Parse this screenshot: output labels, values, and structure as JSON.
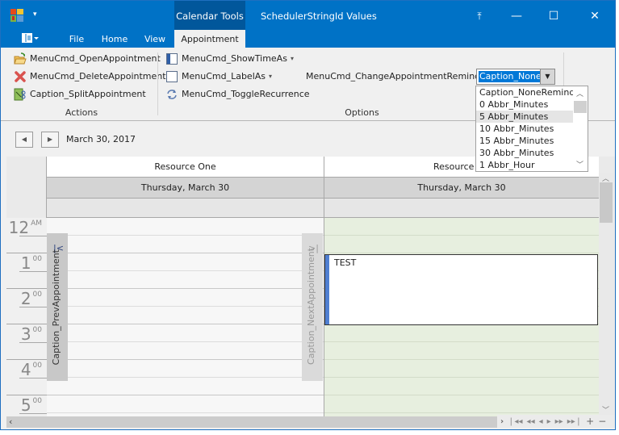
{
  "titlebar": {
    "context_tab": "Calendar Tools",
    "window_title": "SchedulerStringId Values",
    "qat_arrow": "▾",
    "buttons": {
      "restore_ribbon": "⤒",
      "minimize": "—",
      "maximize": "☐",
      "close": "✕"
    }
  },
  "tabs": [
    {
      "label": "File"
    },
    {
      "label": "Home"
    },
    {
      "label": "View"
    },
    {
      "label": "Appointment",
      "active": true
    }
  ],
  "ribbon": {
    "groups": {
      "actions": {
        "label": "Actions",
        "items": [
          {
            "label": "MenuCmd_OpenAppointment",
            "icon": "open-folder-icon"
          },
          {
            "label": "MenuCmd_DeleteAppointment",
            "icon": "delete-x-icon"
          },
          {
            "label": "Caption_SplitAppointment",
            "icon": "split-icon"
          }
        ]
      },
      "options": {
        "label": "Options",
        "items": [
          {
            "label": "MenuCmd_ShowTimeAs",
            "icon": "show-time-as-icon",
            "dropdown": "▾"
          },
          {
            "label": "MenuCmd_LabelAs",
            "icon": "label-as-icon",
            "dropdown": "▾"
          },
          {
            "label": "MenuCmd_ToggleRecurrence",
            "icon": "recurrence-icon"
          }
        ],
        "reminder_label": "MenuCmd_ChangeAppointmentReminderUI",
        "reminder_value": "Caption_NoneR",
        "reminder_options": [
          "Caption_NoneReminder",
          "0 Abbr_Minutes",
          "5 Abbr_Minutes",
          "10 Abbr_Minutes",
          "15 Abbr_Minutes",
          "30 Abbr_Minutes",
          "1 Abbr_Hour"
        ],
        "reminder_hover_index": 2
      }
    }
  },
  "navigator": {
    "date": "March 30, 2017",
    "prev": "◀",
    "next": "▶"
  },
  "scheduler": {
    "resources": [
      "Resource One",
      "Resource T"
    ],
    "day_header": "Thursday, March 30",
    "time_slots": [
      {
        "hour": "12",
        "suffix": "AM"
      },
      {
        "hour": "1",
        "suffix": "00"
      },
      {
        "hour": "2",
        "suffix": "00"
      },
      {
        "hour": "3",
        "suffix": "00"
      },
      {
        "hour": "4",
        "suffix": "00"
      },
      {
        "hour": "5",
        "suffix": "00"
      }
    ],
    "prev_appointment": "Caption_PrevAppointment",
    "prev_glyph": "|<",
    "next_appointment": "Caption_NextAppointment",
    "next_glyph": ">|",
    "appointment": {
      "subject": "TEST",
      "color": "#4f7fd1"
    },
    "work_time_color": "#e7efdf"
  },
  "pager": {
    "buttons": [
      "❘◂◂",
      "◂◂",
      "◂",
      "▸",
      "▸▸",
      "▸▸❘",
      "+",
      "−"
    ]
  }
}
